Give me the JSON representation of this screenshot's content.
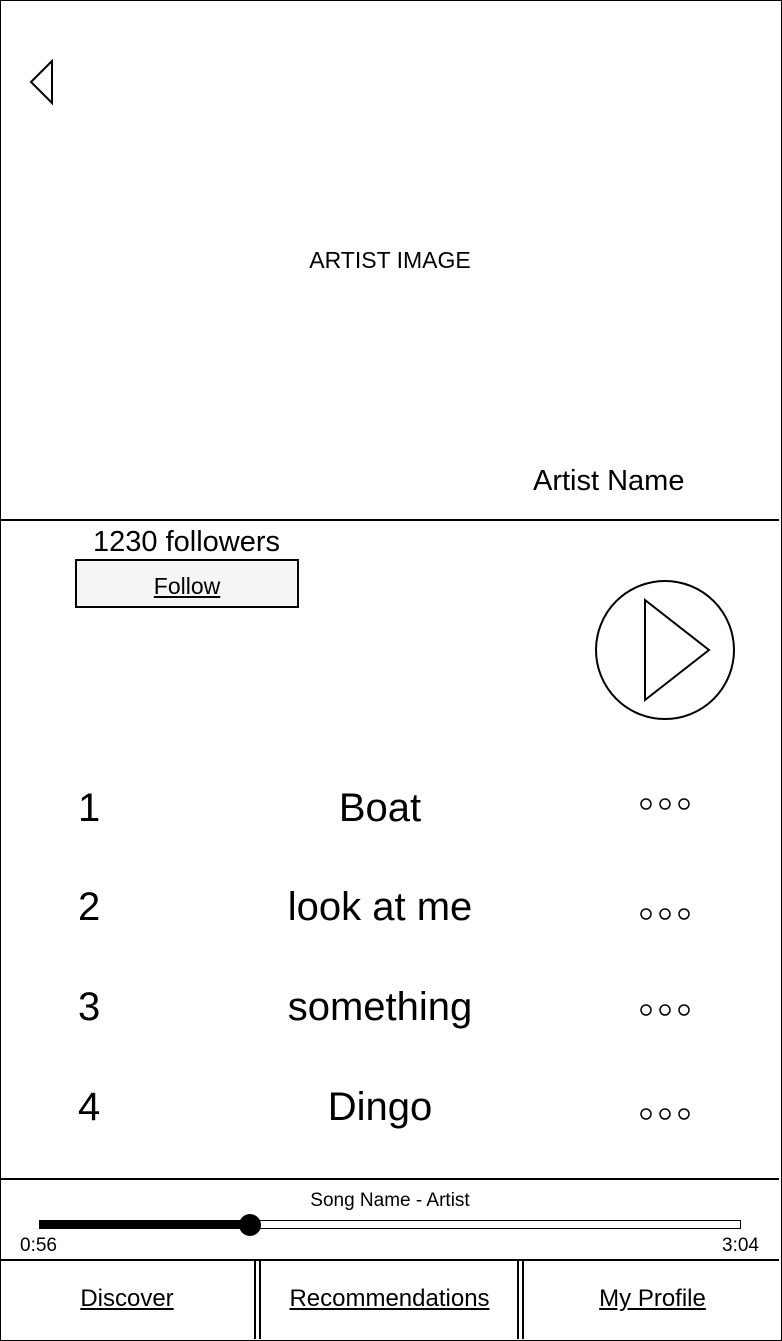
{
  "hero": {
    "image_label": "ARTIST IMAGE",
    "artist_name": "Artist Name"
  },
  "artist": {
    "followers": "1230 followers",
    "follow_label": "Follow"
  },
  "songs": [
    {
      "number": "1",
      "title": "Boat"
    },
    {
      "number": "2",
      "title": "look at me"
    },
    {
      "number": "3",
      "title": "something"
    },
    {
      "number": "4",
      "title": "Dingo"
    }
  ],
  "player": {
    "now_playing": "Song Name - Artist",
    "elapsed": "0:56",
    "duration": "3:04",
    "progress": 0.3
  },
  "tabs": {
    "discover": "Discover",
    "recommendations": "Recommendations",
    "profile": "My Profile"
  }
}
